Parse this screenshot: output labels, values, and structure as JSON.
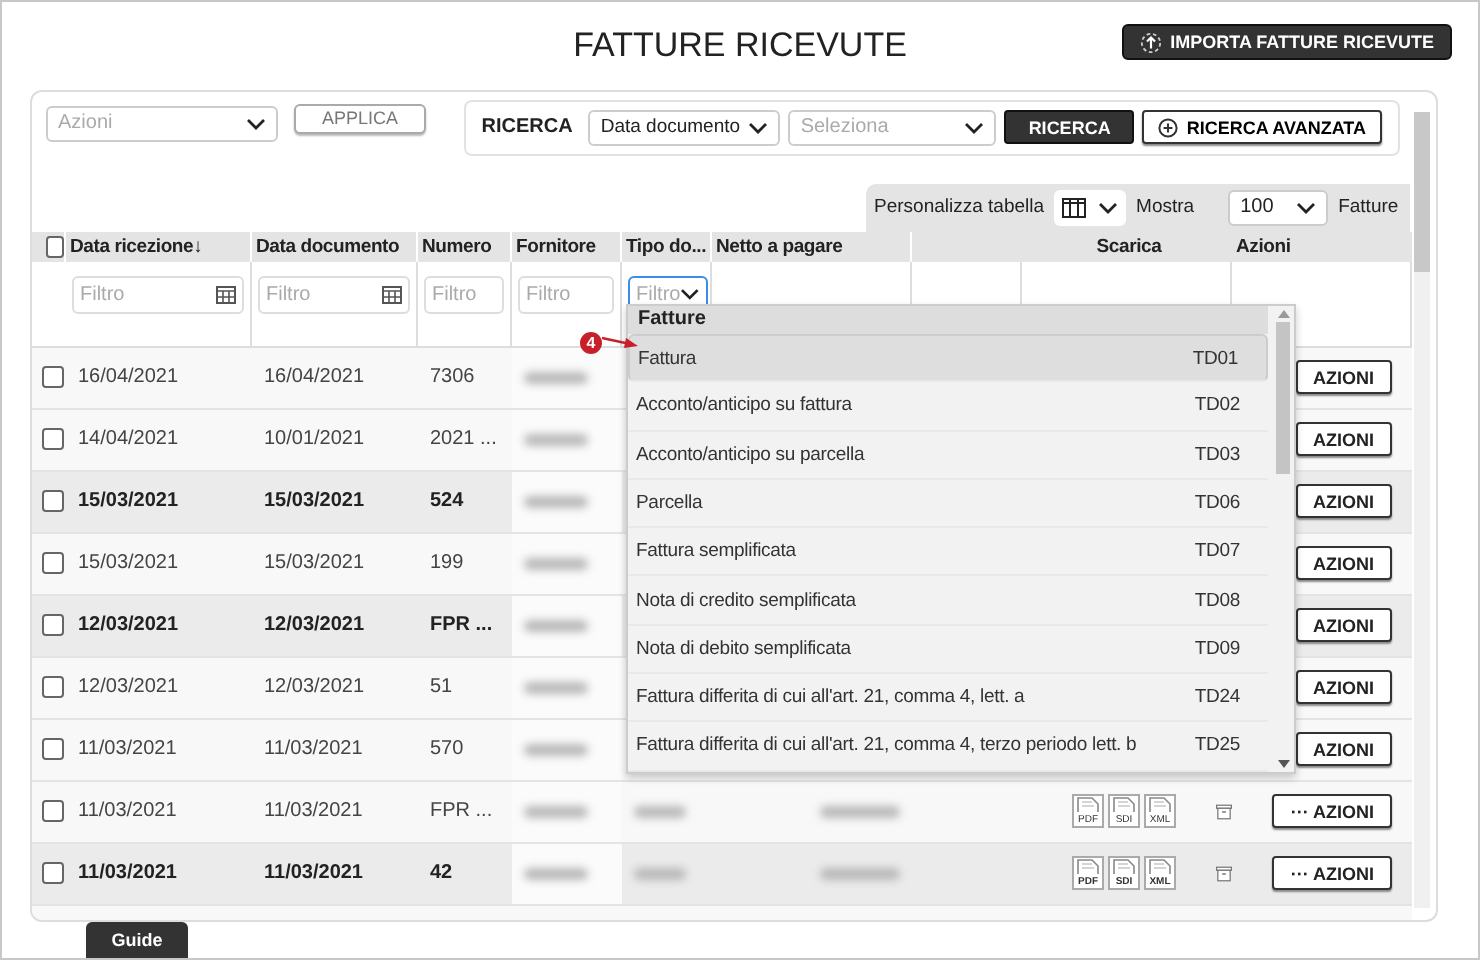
{
  "title": "FATTURE RICEVUTE",
  "import_button": "IMPORTA FATTURE RICEVUTE",
  "toolbar": {
    "actions_placeholder": "Azioni",
    "apply_button": "APPLICA"
  },
  "search": {
    "label": "RICERCA",
    "field_value": "Data documento",
    "select_placeholder": "Seleziona",
    "search_button": "RICERCA",
    "advanced_button": "RICERCA AVANZATA"
  },
  "table_options": {
    "customize_label": "Personalizza tabella",
    "show_label": "Mostra",
    "page_size": "100",
    "unit_label": "Fatture"
  },
  "select_all_checked": false,
  "columns": [
    {
      "label": "Data ricezione",
      "sort_icon": "↓"
    },
    {
      "label": "Data documento"
    },
    {
      "label": "Numero"
    },
    {
      "label": "Fornitore"
    },
    {
      "label": "Tipo do..."
    },
    {
      "label": "Netto a pagare"
    },
    {
      "label": "Scarica"
    },
    {
      "label": "Azioni"
    }
  ],
  "filters": [
    {
      "kind": "date",
      "placeholder": "Filtro"
    },
    {
      "kind": "date",
      "placeholder": "Filtro"
    },
    {
      "kind": "text",
      "placeholder": "Filtro"
    },
    {
      "kind": "text",
      "placeholder": "Filtro"
    },
    {
      "kind": "select",
      "placeholder": "Filtro",
      "focused": true
    }
  ],
  "rows": [
    {
      "checked": false,
      "unread": false,
      "received": "16/04/2021",
      "document_date": "16/04/2021",
      "number": "7306",
      "action_label": "AZIONI"
    },
    {
      "checked": false,
      "unread": false,
      "received": "14/04/2021",
      "document_date": "10/01/2021",
      "number": "2021 ...",
      "action_label": "AZIONI"
    },
    {
      "checked": false,
      "unread": true,
      "received": "15/03/2021",
      "document_date": "15/03/2021",
      "number": "524",
      "action_label": "AZIONI"
    },
    {
      "checked": false,
      "unread": false,
      "received": "15/03/2021",
      "document_date": "15/03/2021",
      "number": "199",
      "action_label": "AZIONI"
    },
    {
      "checked": false,
      "unread": true,
      "received": "12/03/2021",
      "document_date": "12/03/2021",
      "number": "FPR ...",
      "action_label": "AZIONI"
    },
    {
      "checked": false,
      "unread": false,
      "received": "12/03/2021",
      "document_date": "12/03/2021",
      "number": "51",
      "action_label": "AZIONI"
    },
    {
      "checked": false,
      "unread": false,
      "received": "11/03/2021",
      "document_date": "11/03/2021",
      "number": "570",
      "action_label": "AZIONI"
    },
    {
      "checked": false,
      "unread": false,
      "received": "11/03/2021",
      "document_date": "11/03/2021",
      "number": "FPR ...",
      "action_label": "··· AZIONI",
      "downloads": [
        "PDF",
        "SDI",
        "XML"
      ]
    },
    {
      "checked": false,
      "unread": true,
      "received": "11/03/2021",
      "document_date": "11/03/2021",
      "number": "42",
      "action_label": "··· AZIONI",
      "downloads": [
        "PDF",
        "SDI",
        "XML"
      ]
    }
  ],
  "dropdown": {
    "group": "Fatture",
    "options": [
      {
        "label": "Fattura",
        "code": "TD01",
        "selected": true
      },
      {
        "label": "Acconto/anticipo su fattura",
        "code": "TD02",
        "selected": false
      },
      {
        "label": "Acconto/anticipo su parcella",
        "code": "TD03",
        "selected": false
      },
      {
        "label": "Parcella",
        "code": "TD06",
        "selected": false
      },
      {
        "label": "Fattura semplificata",
        "code": "TD07",
        "selected": false
      },
      {
        "label": "Nota di credito semplificata",
        "code": "TD08",
        "selected": false
      },
      {
        "label": "Nota di debito semplificata",
        "code": "TD09",
        "selected": false
      },
      {
        "label": "Fattura differita di cui all'art. 21, comma 4, lett. a",
        "code": "TD24",
        "selected": false
      },
      {
        "label": "Fattura differita di cui all'art. 21, comma 4, terzo periodo lett. b",
        "code": "TD25",
        "selected": false
      }
    ]
  },
  "callout": {
    "number": "4"
  },
  "guide_tab": "Guide"
}
